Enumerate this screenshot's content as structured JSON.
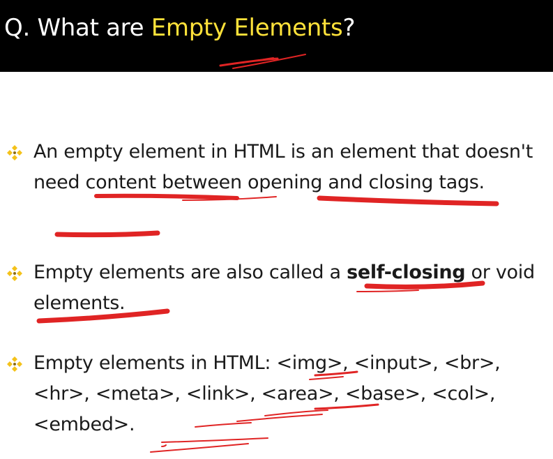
{
  "header": {
    "title_prefix": "Q. What are ",
    "title_highlight": "Empty Elements",
    "title_suffix": "?",
    "highlight_color": "#ffe23a",
    "background_color": "#000000"
  },
  "bullets": [
    {
      "icon": "diamond-bullet-icon",
      "text": "An empty element in HTML is an element that doesn't need content between opening and closing tags."
    },
    {
      "icon": "diamond-bullet-icon",
      "text_before": "Empty elements are also called a ",
      "text_bold": "self-closing",
      "text_after": " or void elements."
    },
    {
      "icon": "diamond-bullet-icon",
      "text": "Empty elements in HTML: <img>, <input>, <br>, <hr>, <meta>, <link>, <area>, <base>, <col>, <embed>."
    }
  ],
  "annotation_color": "#e02424"
}
